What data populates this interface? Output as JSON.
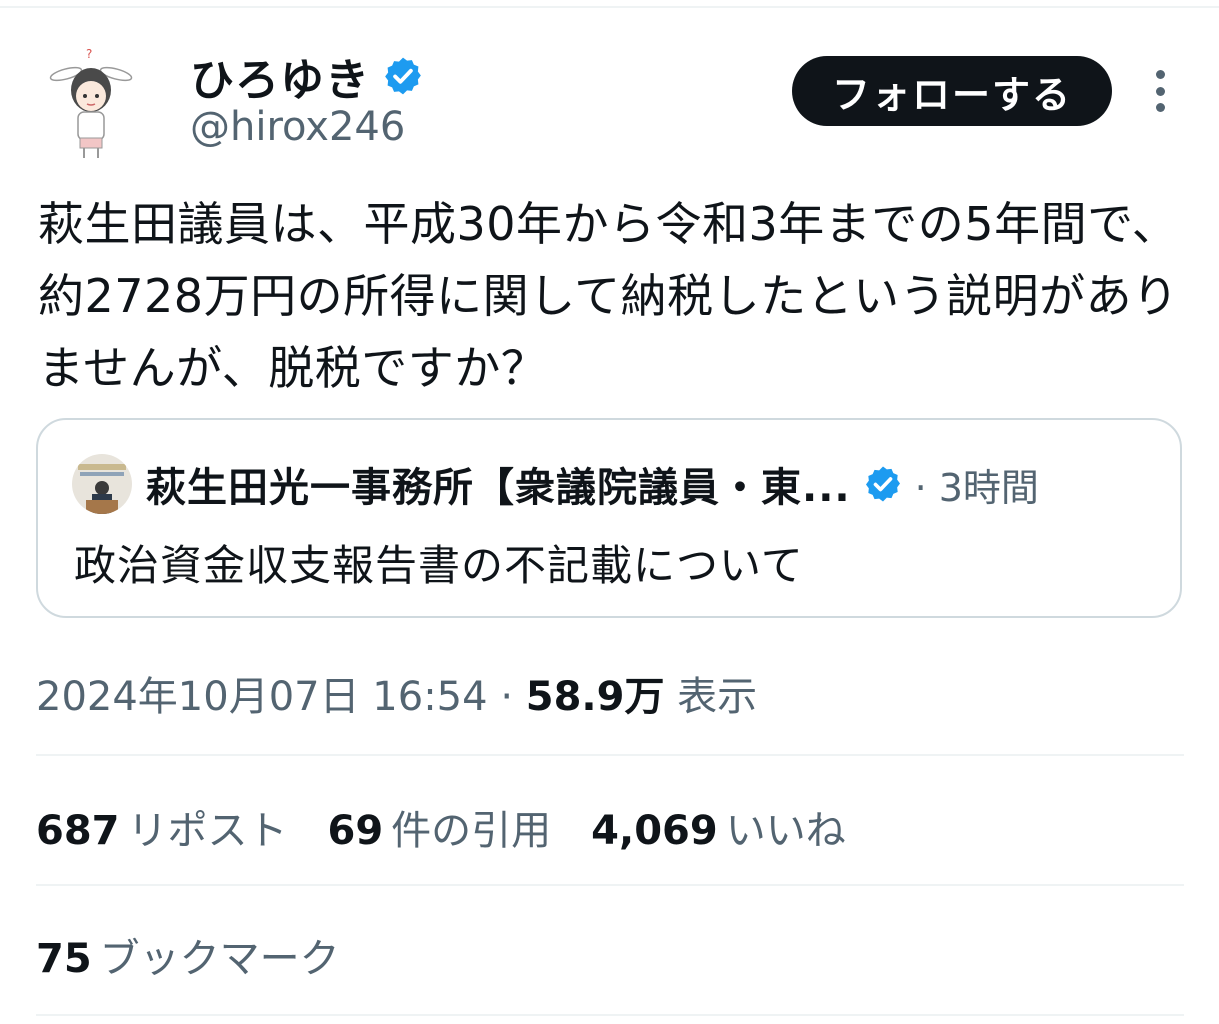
{
  "author": {
    "display_name": "ひろゆき",
    "handle": "@hirox246",
    "verified_icon": "verified-badge-icon",
    "avatar_icon": "character-avatar"
  },
  "follow_button": {
    "label": "フォローする"
  },
  "more_icon": "more-vertical-icon",
  "tweet": {
    "text": "萩生田議員は、平成30年から令和3年までの5年間で、約2728万円の所得に関して納税したという説明がありませんが、脱税ですか？"
  },
  "quote": {
    "author": "萩生田光一事務所【衆議院議員・東...",
    "time": "· 3時間",
    "text": "政治資金収支報告書の不記載について"
  },
  "meta": {
    "timestamp": "2024年10月07日 16:54",
    "separator": "·",
    "views_count": "58.9万",
    "views_label": "表示"
  },
  "stats": {
    "reposts": {
      "count": "687",
      "label": "リポスト"
    },
    "quotes": {
      "count": "69",
      "label": "件の引用"
    },
    "likes": {
      "count": "4,069",
      "label": "いいね"
    },
    "bookmarks": {
      "count": "75",
      "label": "ブックマーク"
    }
  },
  "colors": {
    "text": "#0f1419",
    "secondary": "#536471",
    "border": "#cfd9de",
    "verified": "#1d9bf0",
    "follow_bg": "#0f1419"
  }
}
